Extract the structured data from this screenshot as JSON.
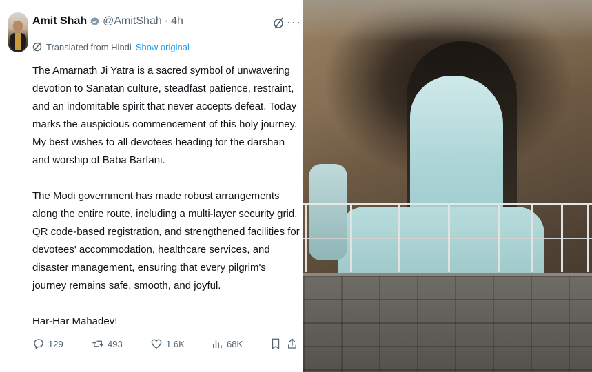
{
  "post": {
    "author_name": "Amit Shah",
    "handle": "@AmitShah",
    "separator": "·",
    "time": "4h",
    "translation_note": "Translated from Hindi",
    "show_original": "Show original",
    "paragraphs": [
      "The Amarnath Ji Yatra is a sacred symbol of unwavering devotion to Sanatan culture, steadfast patience, restraint, and an indomitable spirit that never accepts defeat. Today marks the auspicious commencement of this holy journey. My best wishes to all devotees heading for the darshan and worship of Baba Barfani.",
      "The Modi government has made robust arrangements along the entire route, including a multi-layer security grid, QR code-based registration, and strengthened facilities for devotees' accommodation, healthcare services, and disaster management, ensuring that every pilgrim's journey remains safe, smooth, and joyful.",
      "Har-Har Mahadev!"
    ],
    "more_label": "···"
  },
  "actions": {
    "replies": "129",
    "reposts": "493",
    "likes": "1.6K",
    "views": "68K"
  },
  "icons": {
    "verified": "verified-badge-icon",
    "grok": "grok-icon",
    "translate": "translate-icon",
    "reply": "reply-icon",
    "repost": "repost-icon",
    "like": "heart-icon",
    "views": "views-chart-icon",
    "bookmark": "bookmark-icon",
    "share": "share-icon"
  },
  "colors": {
    "text": "#0f1419",
    "secondary": "#536471",
    "link": "#1d9bf0",
    "verified_badge": "#829aab"
  }
}
